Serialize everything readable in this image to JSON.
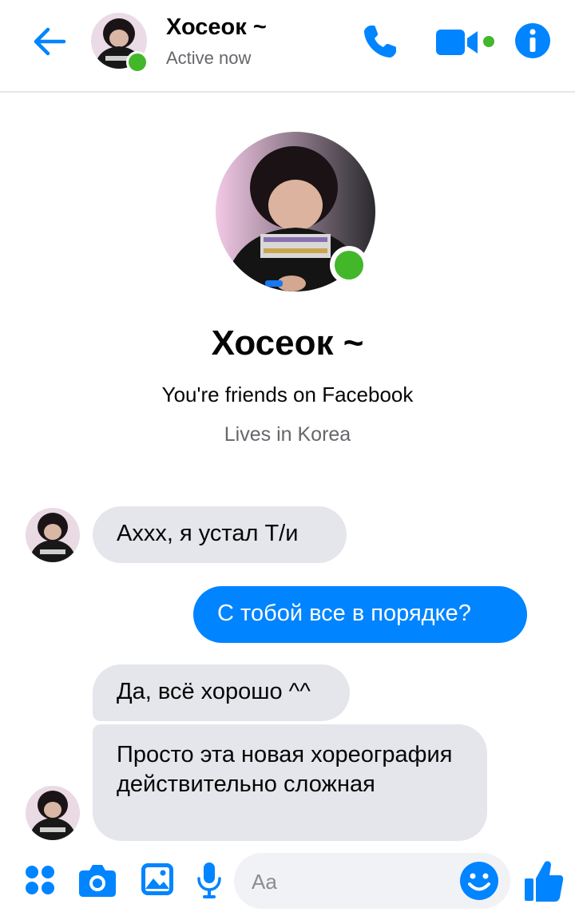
{
  "header": {
    "name": "Хосеок ~",
    "status": "Active now"
  },
  "profile": {
    "name": "Хосеок ~",
    "friends_text": "You're friends on Facebook",
    "location_text": "Lives in Korea"
  },
  "messages": [
    {
      "direction": "incoming",
      "text": "Ахxx, я устал Т/и"
    },
    {
      "direction": "outgoing",
      "text": "С тобой все в порядке?"
    },
    {
      "direction": "incoming",
      "text": "Да, всё хорошо ^^"
    },
    {
      "direction": "incoming",
      "text": "Просто эта новая хореография действительно сложная"
    }
  ],
  "composer": {
    "placeholder": "Aa"
  },
  "colors": {
    "accent": "#0084ff",
    "presence": "#42b72a",
    "incoming_bubble": "#e4e6eb",
    "secondary_text": "#65676b"
  },
  "icons": [
    "back-arrow-icon",
    "phone-icon",
    "video-camera-icon",
    "info-icon",
    "apps-icon",
    "camera-icon",
    "photo-icon",
    "microphone-icon",
    "emoji-icon",
    "thumbs-up-icon"
  ]
}
